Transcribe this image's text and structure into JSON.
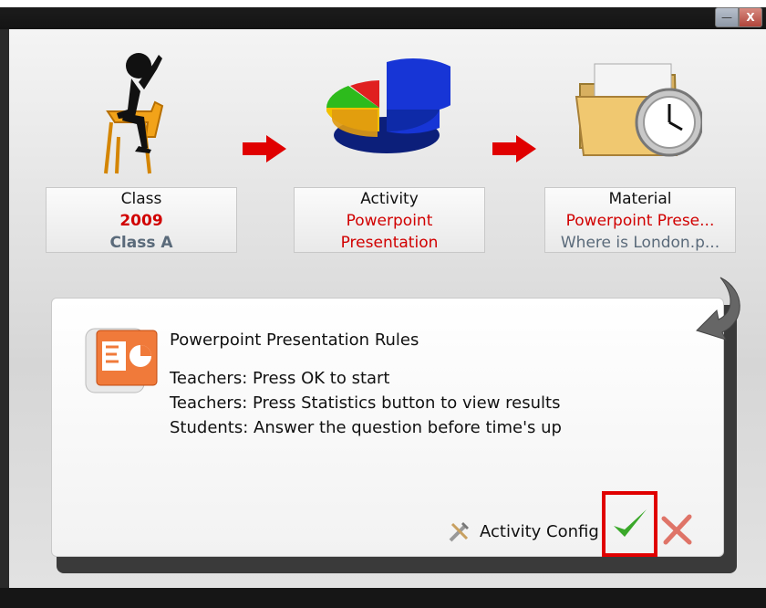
{
  "window": {
    "minimize_label": "—",
    "close_label": "X"
  },
  "steps": [
    {
      "title": "Class",
      "line1": "2009",
      "line2": "Class A",
      "icon": "person-sitting-icon"
    },
    {
      "title": "Activity",
      "line1": "Powerpoint",
      "line2": "Presentation",
      "icon": "pie-chart-icon"
    },
    {
      "title": "Material",
      "line1": "Powerpoint Prese...",
      "line2": "Where is London.p...",
      "icon": "folder-clock-icon"
    }
  ],
  "dialog": {
    "title": "Powerpoint Presentation Rules",
    "rules": [
      "Teachers: Press OK to start",
      "Teachers: Press Statistics button to view results",
      "Students: Answer the question before time's up"
    ],
    "config_label": "Activity Config",
    "icon": "powerpoint-icon"
  },
  "colors": {
    "accent_red": "#d10000",
    "highlight_red": "#e00000",
    "ok_green": "#3aa82a"
  }
}
